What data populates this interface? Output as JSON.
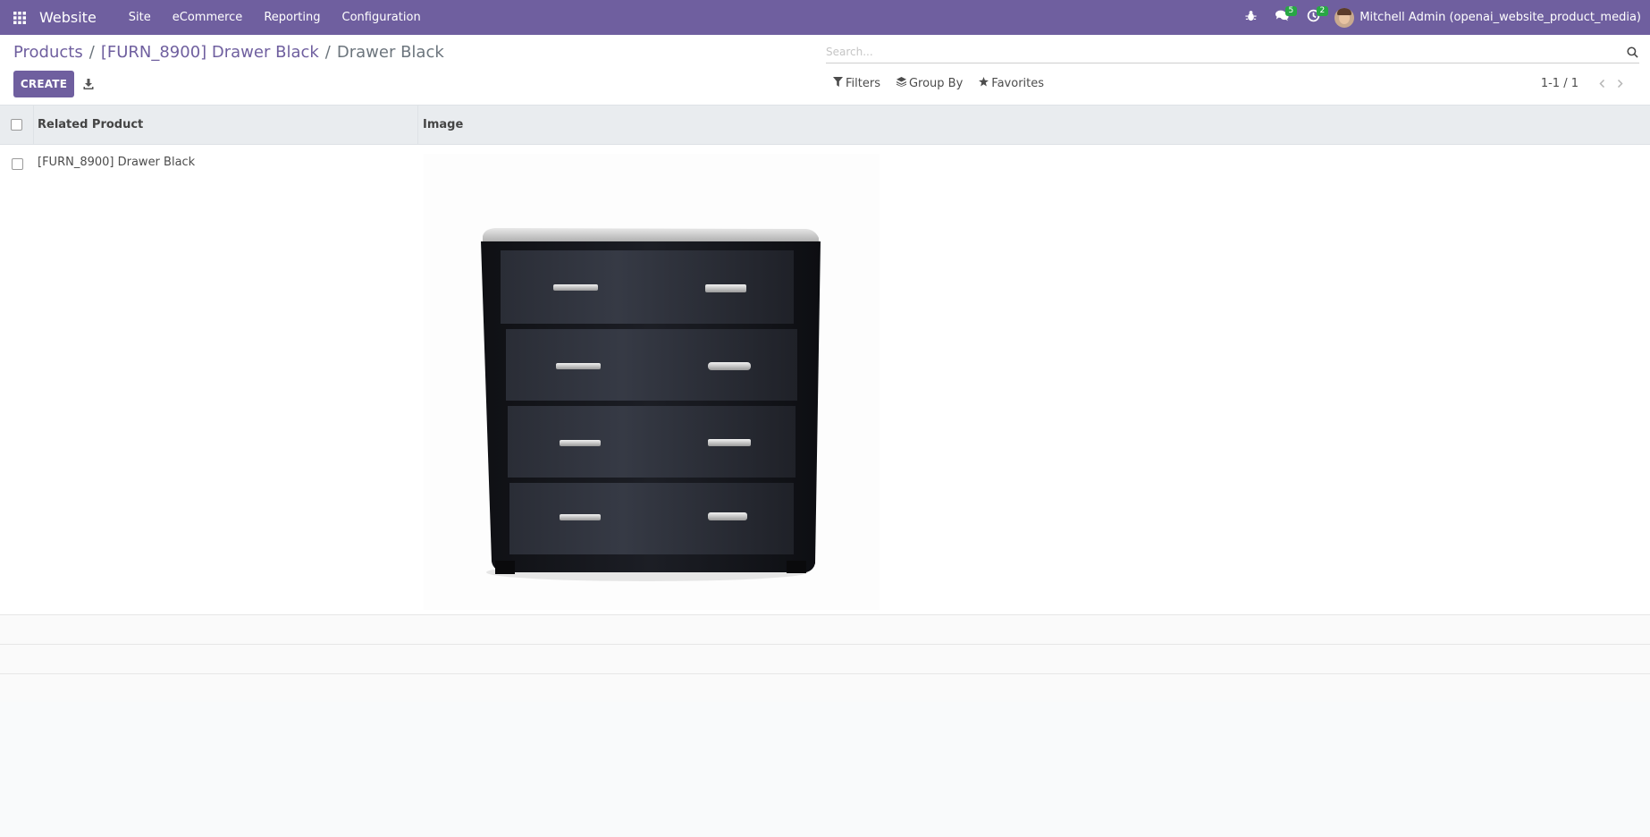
{
  "navbar": {
    "app_name": "Website",
    "menu": [
      "Site",
      "eCommerce",
      "Reporting",
      "Configuration"
    ],
    "messages_count": "5",
    "activities_count": "2",
    "user_name": "Mitchell Admin (openai_website_product_media)"
  },
  "breadcrumb": {
    "items": [
      "Products",
      "[FURN_8900] Drawer Black"
    ],
    "separator": "/",
    "current": "Drawer Black"
  },
  "toolbar": {
    "create_label": "CREATE"
  },
  "search": {
    "placeholder": "Search..."
  },
  "filters": {
    "filters_label": "Filters",
    "group_by_label": "Group By",
    "favorites_label": "Favorites"
  },
  "pager": {
    "value": "1-1 / 1"
  },
  "table": {
    "headers": [
      "Related Product",
      "Image"
    ],
    "rows": [
      {
        "related_product": "[FURN_8900] Drawer Black",
        "image": "black-chest-of-drawers"
      }
    ]
  },
  "colors": {
    "navbar": "#6f5f9f",
    "brand": "#6f5f9f",
    "badge": "#28a745"
  },
  "icons": {
    "apps": "apps-grid-icon",
    "debug": "bug-icon",
    "messages": "chat-icon",
    "activities": "clock-icon",
    "download": "download-icon",
    "search": "search-icon",
    "filters": "filter-icon",
    "group_by": "layers-icon",
    "favorites": "star-icon",
    "pager_prev": "chevron-left-icon",
    "pager_next": "chevron-right-icon"
  }
}
